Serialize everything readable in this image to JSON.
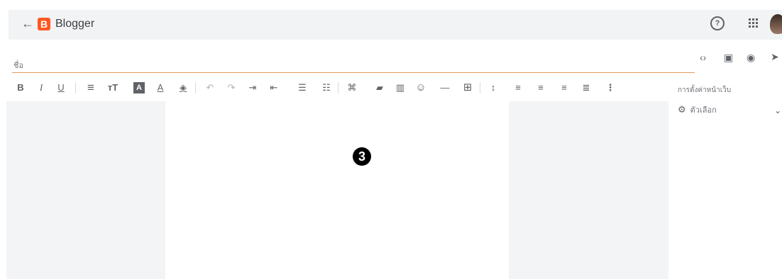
{
  "header": {
    "back_icon": "←",
    "logo_letter": "B",
    "app_name": "Blogger",
    "help_icon": "?",
    "avatar": "avatar"
  },
  "title_field": {
    "placeholder": "ชื่อ",
    "value": ""
  },
  "right_icons": {
    "html_view": "‹›",
    "save": "▣",
    "preview": "◉",
    "publish": "➤"
  },
  "toolbar": {
    "bold": "B",
    "italic": "I",
    "underline": "U",
    "align_menu": "≡",
    "font_size": "тT",
    "text_bg": "A",
    "text_color": "A",
    "fill": "◈",
    "undo": "↶",
    "redo": "↷",
    "indent": "⇥",
    "outdent": "⇤",
    "bullets": "☰",
    "numbers": "☷",
    "link": "⌘",
    "image": "▰",
    "video": "▥",
    "emoji": "☺",
    "separator": "—",
    "table": "⊞",
    "line_spacing": "↕",
    "align_left": "≡",
    "align_center": "≡",
    "align_right": "≡",
    "justify": "≣",
    "more": "⋮"
  },
  "sidebar": {
    "section_title": "การตั้งค่าหน้าเว็บ",
    "options_label": "ตัวเลือก",
    "chevron": "⌄"
  },
  "canvas": {
    "marker_label": "3"
  }
}
